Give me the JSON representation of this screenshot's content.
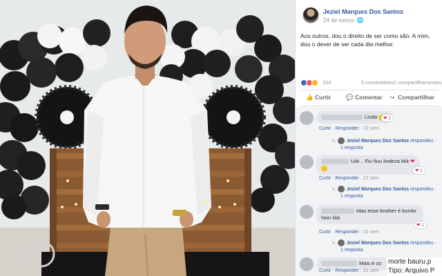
{
  "post": {
    "author": "Jeziel Marques Dos Santos",
    "date": "24 de março",
    "privacy_icon": "globe-icon",
    "text": "Aos outros, dou o direito de ser como são. A mim, dou o dever de ser cada dia melhor.",
    "reaction_count": "204",
    "comments_count": "5 comentários",
    "shares_count": "2 compartilhamentos"
  },
  "actions": {
    "like_label": "Curtir",
    "comment_label": "Comentar",
    "share_label": "Compartilhar"
  },
  "comments": [
    {
      "text": "Lindo",
      "reactions": "1",
      "like": "Curtir",
      "reply": "Responder",
      "time": "22 sem",
      "reply_author": "Jeziel Marques Dos Santos",
      "reply_verb": "respondeu",
      "reply_dot": "·",
      "reply_count": "1 resposta"
    },
    {
      "text": "Uiiii .. Fiu fiuu lindeza kkk",
      "reactions": "1",
      "like": "Curtir",
      "reply": "Responder",
      "time": "22 sem",
      "reply_author": "Jeziel Marques Dos Santos",
      "reply_verb": "respondeu",
      "reply_dot": "·",
      "reply_count": "1 resposta"
    },
    {
      "text": "Mas esse brother é bonito hein kkk",
      "reactions": "1",
      "like": "Curtir",
      "reply": "Responder",
      "time": "22 sem",
      "reply_author": "Jeziel Marques Dos Santos",
      "reply_verb": "respondeu",
      "reply_dot": "·",
      "reply_count": "1 resposta"
    },
    {
      "text": "Mais é co",
      "like": "Curtir",
      "reply": "Responder",
      "time": "22 sem"
    }
  ],
  "separator": "·",
  "watermark": {
    "line1": "morte bauru.p",
    "line2": "Tipo: Arquivo P"
  },
  "colors": {
    "link_blue": "#365899",
    "like_blue": "#4267b2",
    "love_red": "#f25268",
    "wow_yellow": "#f7b928"
  }
}
